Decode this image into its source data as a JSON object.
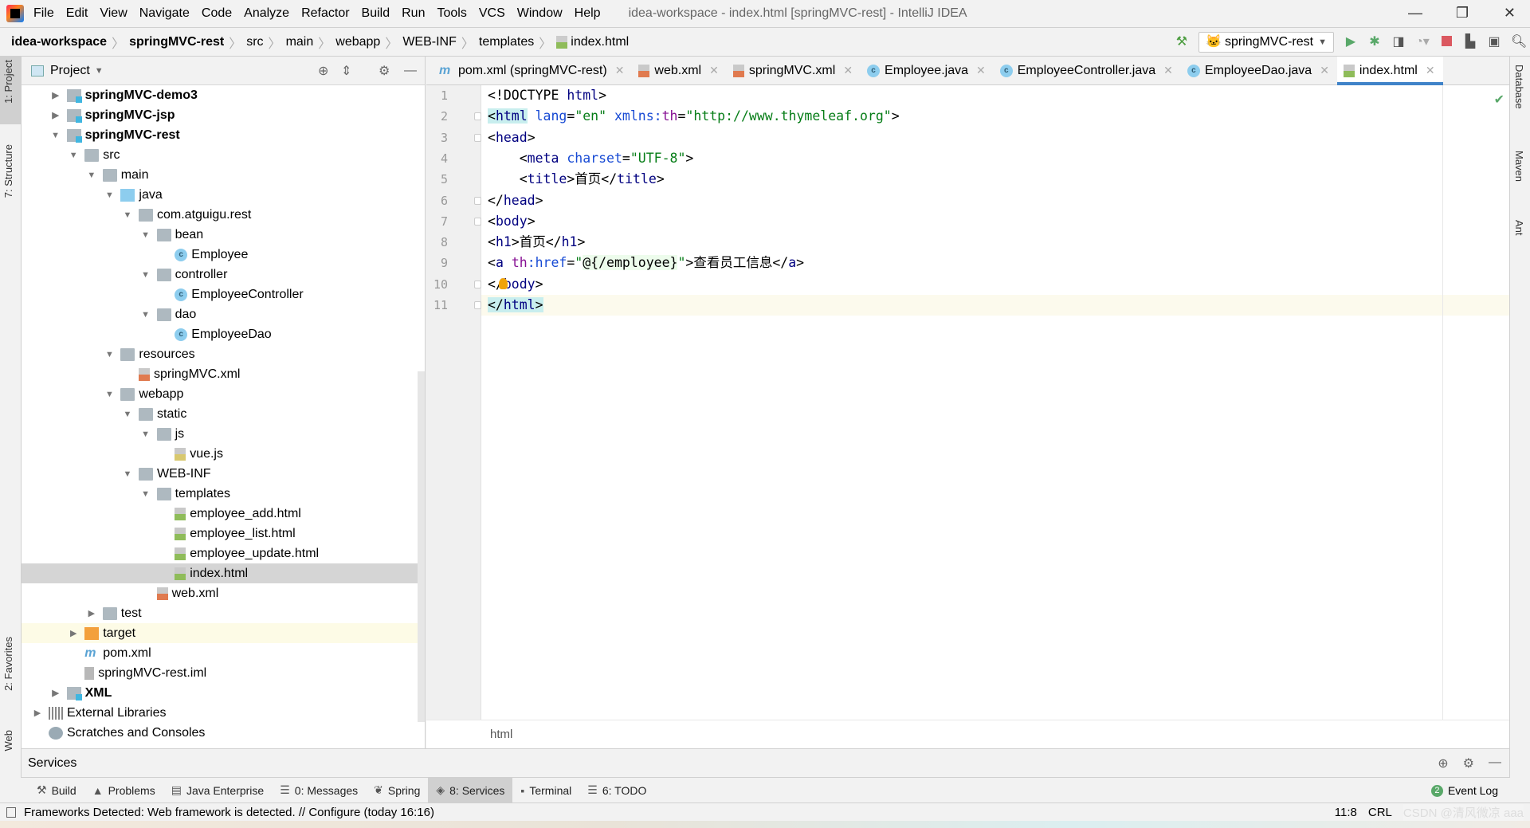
{
  "app": {
    "title": "idea-workspace - index.html [springMVC-rest] - IntelliJ IDEA",
    "menu": [
      "File",
      "Edit",
      "View",
      "Navigate",
      "Code",
      "Analyze",
      "Refactor",
      "Build",
      "Run",
      "Tools",
      "VCS",
      "Window",
      "Help"
    ],
    "window_controls": {
      "minimize": "—",
      "restore": "❐",
      "close": "✕"
    }
  },
  "breadcrumb": [
    {
      "label": "idea-workspace",
      "bold": true
    },
    {
      "label": "springMVC-rest",
      "bold": true
    },
    {
      "label": "src"
    },
    {
      "label": "main"
    },
    {
      "label": "webapp"
    },
    {
      "label": "WEB-INF"
    },
    {
      "label": "templates"
    },
    {
      "label": "index.html",
      "icon": "html-file-icon"
    }
  ],
  "toolbar": {
    "run_config": "springMVC-rest",
    "colors": {
      "run": "#59a869",
      "stop": "#db5860",
      "build": "#4a9c3e"
    }
  },
  "left_strip": {
    "project": "1: Project",
    "structure": "7: Structure",
    "favorites": "2: Favorites",
    "web": "Web"
  },
  "right_strip": {
    "database": "Database",
    "maven": "Maven",
    "ant": "Ant"
  },
  "project": {
    "title": "Project",
    "tree": [
      {
        "label": "springMVC-demo3",
        "depth": 1,
        "arrow": "collapsed",
        "icon": "module",
        "bold": true
      },
      {
        "label": "springMVC-jsp",
        "depth": 1,
        "arrow": "collapsed",
        "icon": "module",
        "bold": true
      },
      {
        "label": "springMVC-rest",
        "depth": 1,
        "arrow": "expanded",
        "icon": "module",
        "bold": true
      },
      {
        "label": "src",
        "depth": 2,
        "arrow": "expanded",
        "icon": "folder"
      },
      {
        "label": "main",
        "depth": 3,
        "arrow": "expanded",
        "icon": "folder"
      },
      {
        "label": "java",
        "depth": 4,
        "arrow": "expanded",
        "icon": "src"
      },
      {
        "label": "com.atguigu.rest",
        "depth": 5,
        "arrow": "expanded",
        "icon": "folder"
      },
      {
        "label": "bean",
        "depth": 6,
        "arrow": "expanded",
        "icon": "folder"
      },
      {
        "label": "Employee",
        "depth": 7,
        "icon": "class"
      },
      {
        "label": "controller",
        "depth": 6,
        "arrow": "expanded",
        "icon": "folder"
      },
      {
        "label": "EmployeeController",
        "depth": 7,
        "icon": "class"
      },
      {
        "label": "dao",
        "depth": 6,
        "arrow": "expanded",
        "icon": "folder"
      },
      {
        "label": "EmployeeDao",
        "depth": 7,
        "icon": "class"
      },
      {
        "label": "resources",
        "depth": 4,
        "arrow": "expanded",
        "icon": "folder"
      },
      {
        "label": "springMVC.xml",
        "depth": 5,
        "icon": "xml"
      },
      {
        "label": "webapp",
        "depth": 4,
        "arrow": "expanded",
        "icon": "folder"
      },
      {
        "label": "static",
        "depth": 5,
        "arrow": "expanded",
        "icon": "folder"
      },
      {
        "label": "js",
        "depth": 6,
        "arrow": "expanded",
        "icon": "folder"
      },
      {
        "label": "vue.js",
        "depth": 7,
        "icon": "js"
      },
      {
        "label": "WEB-INF",
        "depth": 5,
        "arrow": "expanded",
        "icon": "folder"
      },
      {
        "label": "templates",
        "depth": 6,
        "arrow": "expanded",
        "icon": "folder"
      },
      {
        "label": "employee_add.html",
        "depth": 7,
        "icon": "html"
      },
      {
        "label": "employee_list.html",
        "depth": 7,
        "icon": "html"
      },
      {
        "label": "employee_update.html",
        "depth": 7,
        "icon": "html"
      },
      {
        "label": "index.html",
        "depth": 7,
        "icon": "html",
        "selected": true
      },
      {
        "label": "web.xml",
        "depth": 6,
        "icon": "xml"
      },
      {
        "label": "test",
        "depth": 3,
        "arrow": "collapsed",
        "icon": "folder"
      },
      {
        "label": "target",
        "depth": 2,
        "arrow": "collapsed",
        "icon": "target",
        "highlight": true
      },
      {
        "label": "pom.xml",
        "depth": 2,
        "icon": "pom"
      },
      {
        "label": "springMVC-rest.iml",
        "depth": 2,
        "icon": "iml"
      },
      {
        "label": "XML",
        "depth": 1,
        "arrow": "collapsed",
        "icon": "module",
        "bold": true
      },
      {
        "label": "External Libraries",
        "depth": 0,
        "arrow": "collapsed",
        "icon": "lib"
      },
      {
        "label": "Scratches and Consoles",
        "depth": 0,
        "icon": "scratch"
      }
    ]
  },
  "tabs": [
    {
      "label": "pom.xml (springMVC-rest)",
      "icon": "pom"
    },
    {
      "label": "web.xml",
      "icon": "xml"
    },
    {
      "label": "springMVC.xml",
      "icon": "xml"
    },
    {
      "label": "Employee.java",
      "icon": "class"
    },
    {
      "label": "EmployeeController.java",
      "icon": "class"
    },
    {
      "label": "EmployeeDao.java",
      "icon": "class"
    },
    {
      "label": "index.html",
      "icon": "html",
      "active": true
    }
  ],
  "editor": {
    "current_line": 11,
    "breadcrumb": "html",
    "lines": [
      [
        [
          "<!DOCTYPE ",
          "doc"
        ],
        [
          "html",
          "tag"
        ],
        [
          ">",
          "br"
        ]
      ],
      [
        [
          "<",
          "br",
          "hlt"
        ],
        [
          "html",
          "tag",
          "hlt"
        ],
        [
          " ",
          "txt"
        ],
        [
          "lang",
          "attr"
        ],
        [
          "=",
          "br"
        ],
        [
          "\"en\"",
          "str"
        ],
        [
          " ",
          "txt"
        ],
        [
          "xmlns:",
          "attr"
        ],
        [
          "th",
          "ns"
        ],
        [
          "=",
          "br"
        ],
        [
          "\"http://www.thymeleaf.org\"",
          "str"
        ],
        [
          ">",
          "br"
        ]
      ],
      [
        [
          "<",
          "br"
        ],
        [
          "head",
          "tag"
        ],
        [
          ">",
          "br"
        ]
      ],
      [
        [
          "    <",
          "br"
        ],
        [
          "meta",
          "tag"
        ],
        [
          " ",
          "txt"
        ],
        [
          "charset",
          "attr"
        ],
        [
          "=",
          "br"
        ],
        [
          "\"UTF-8\"",
          "str"
        ],
        [
          ">",
          "br"
        ]
      ],
      [
        [
          "    <",
          "br"
        ],
        [
          "title",
          "tag"
        ],
        [
          ">",
          "br"
        ],
        [
          "首页",
          "txt"
        ],
        [
          "</",
          "br"
        ],
        [
          "title",
          "tag"
        ],
        [
          ">",
          "br"
        ]
      ],
      [
        [
          "</",
          "br"
        ],
        [
          "head",
          "tag"
        ],
        [
          ">",
          "br"
        ]
      ],
      [
        [
          "<",
          "br"
        ],
        [
          "body",
          "tag"
        ],
        [
          ">",
          "br"
        ]
      ],
      [
        [
          "<",
          "br"
        ],
        [
          "h1",
          "tag"
        ],
        [
          ">",
          "br"
        ],
        [
          "首页",
          "txt"
        ],
        [
          "</",
          "br"
        ],
        [
          "h1",
          "tag"
        ],
        [
          ">",
          "br"
        ]
      ],
      [
        [
          "<",
          "br"
        ],
        [
          "a",
          "tag"
        ],
        [
          " ",
          "txt"
        ],
        [
          "th",
          "ns"
        ],
        [
          ":href",
          "attr"
        ],
        [
          "=",
          "br"
        ],
        [
          "\"",
          "str"
        ],
        [
          "@{/employee}",
          "txt",
          "hlg"
        ],
        [
          "\"",
          "str"
        ],
        [
          ">",
          "br"
        ],
        [
          "查看员工信息",
          "txt"
        ],
        [
          "</",
          "br"
        ],
        [
          "a",
          "tag"
        ],
        [
          ">",
          "br"
        ]
      ],
      [
        [
          "</",
          "br"
        ],
        [
          "body",
          "tag"
        ],
        [
          ">",
          "br"
        ]
      ],
      [
        [
          "</",
          "br",
          "hlt"
        ],
        [
          "html",
          "tag",
          "hlt"
        ],
        [
          ">",
          "br",
          "hlt"
        ]
      ]
    ],
    "folds": [
      2,
      3,
      6,
      7,
      10,
      11
    ]
  },
  "services": {
    "title": "Services"
  },
  "tool_windows": [
    {
      "label": "Build",
      "icon": "hammer-icon"
    },
    {
      "label": "Problems",
      "icon": "warning-icon"
    },
    {
      "label": "Java Enterprise",
      "icon": "java-enterprise-icon"
    },
    {
      "label": "0: Messages",
      "icon": "messages-icon"
    },
    {
      "label": "Spring",
      "icon": "spring-icon"
    },
    {
      "label": "8: Services",
      "icon": "services-icon",
      "active": true
    },
    {
      "label": "Terminal",
      "icon": "terminal-icon"
    },
    {
      "label": "6: TODO",
      "icon": "todo-icon"
    }
  ],
  "event_log": {
    "label": "Event Log",
    "count": "2"
  },
  "status": {
    "message": "Frameworks Detected: Web framework is detected. // Configure (today 16:16)",
    "position": "11:8",
    "line_sep": "CRL",
    "watermark": "CSDN @清风微凉 aaa"
  }
}
